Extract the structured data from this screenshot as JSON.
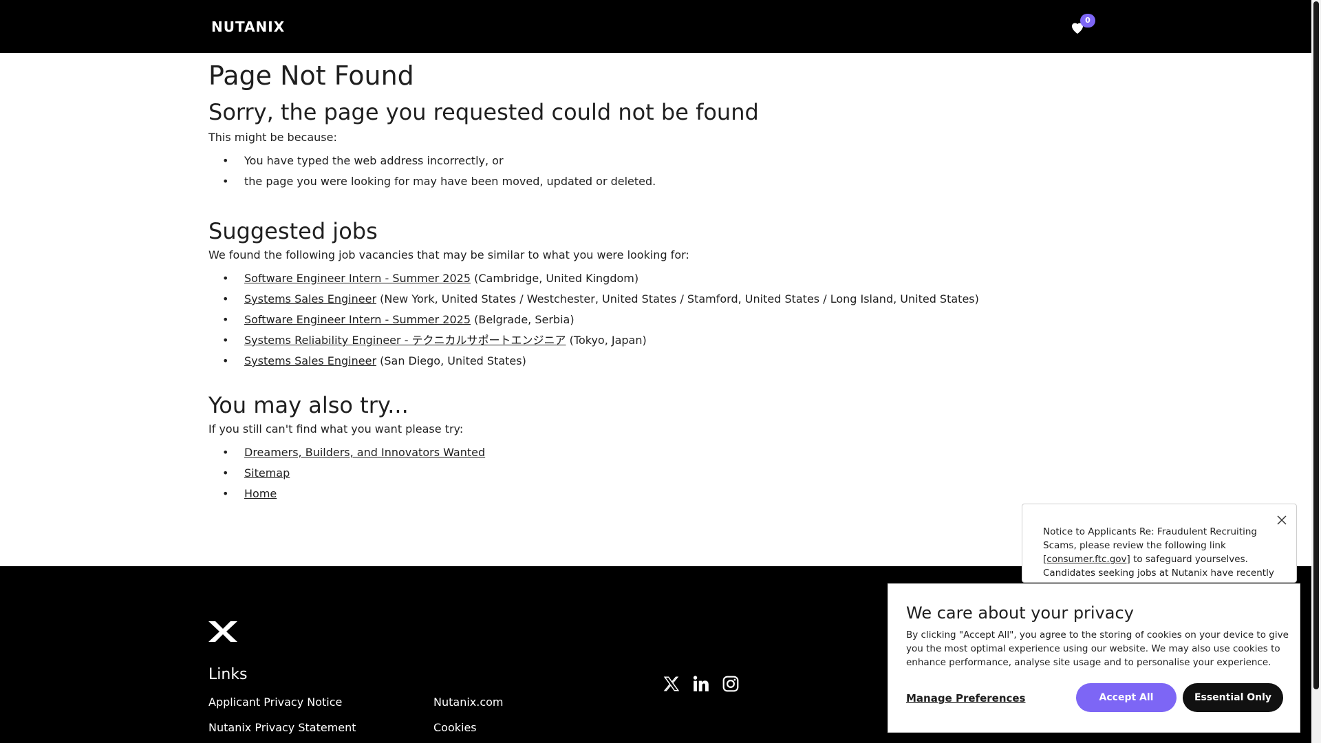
{
  "header": {
    "logo": "NUTANIX",
    "saved_count": "0"
  },
  "main": {
    "title": "Page Not Found",
    "subtitle": "Sorry, the page you requested could not be found",
    "reason_intro": "This might be because:",
    "reasons": [
      "You have typed the web address incorrectly, or",
      "the page you were looking for may have been moved, updated or deleted."
    ],
    "suggested_title": "Suggested jobs",
    "suggested_intro": "We found the following job vacancies that may be similar to what you were looking for:",
    "jobs": [
      {
        "title": "Software Engineer Intern - Summer 2025",
        "location": "(Cambridge, United Kingdom)"
      },
      {
        "title": "Systems Sales Engineer",
        "location": "(New York, United States / Westchester, United States / Stamford, United States / Long Island, United States)"
      },
      {
        "title": "Software Engineer Intern - Summer 2025",
        "location": "(Belgrade, Serbia)"
      },
      {
        "title": "Systems Reliability Engineer - テクニカルサポートエンジニア",
        "location": "(Tokyo, Japan)"
      },
      {
        "title": "Systems Sales Engineer",
        "location": "(San Diego, United States)"
      }
    ],
    "also_title": "You may also try...",
    "also_intro": "If you still can't find what you want please try:",
    "also_links": [
      "Dreamers, Builders, and Innovators Wanted",
      "Sitemap",
      "Home"
    ]
  },
  "footer": {
    "links_title": "Links",
    "links": [
      "Applicant Privacy Notice",
      "Nutanix.com",
      "Nutanix Privacy Statement",
      "Cookies"
    ],
    "social": [
      "x-icon",
      "linkedin-icon",
      "instagram-icon"
    ]
  },
  "notice": {
    "text_before": "Notice to Applicants Re: Fraudulent Recruiting Scams, please review the following link [",
    "link": "consumer.ftc.gov",
    "text_after": "] to safeguard yourselves. Candidates seeking jobs at Nutanix have recently"
  },
  "cookie": {
    "title": "We care about your privacy",
    "text": "By clicking \"Accept All\", you agree to the storing of cookies on your device to give you the most optimal experience using our website. We may also use cookies to enhance performance, analyse site usage and to personalise your experience.",
    "manage": "Manage Preferences",
    "accept": "Accept All",
    "essential": "Essential Only"
  },
  "colors": {
    "accent": "#7d66f5",
    "header_bg": "#000000",
    "text": "#1f1f1f"
  }
}
